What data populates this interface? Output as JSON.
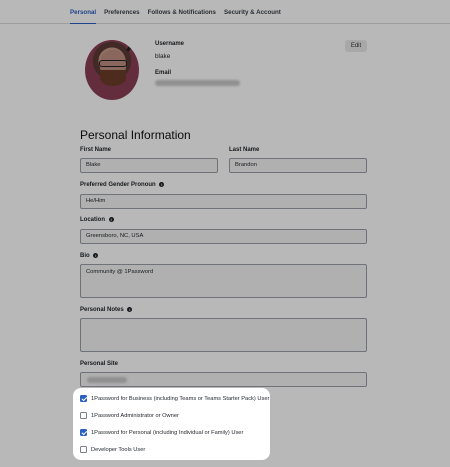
{
  "tabs": [
    "Personal",
    "Preferences",
    "Follows & Notifications",
    "Security & Account"
  ],
  "profile": {
    "username_label": "Username",
    "username": "blake",
    "email_label": "Email",
    "edit_label": "Edit"
  },
  "section_title": "Personal Information",
  "fields": {
    "first_name_label": "First Name",
    "first_name": "Blake",
    "last_name_label": "Last Name",
    "last_name": "Brandon",
    "pronoun_label": "Preferred Gender Pronoun",
    "pronoun": "He/Him",
    "location_label": "Location",
    "location": "Greensboro, NC, USA",
    "bio_label": "Bio",
    "bio": "Community @ 1Password",
    "notes_label": "Personal Notes",
    "notes": "",
    "site_label": "Personal Site"
  },
  "checkboxes": [
    {
      "label": "1Password for Business (including Teams or Teams Starter Pack) User",
      "checked": true
    },
    {
      "label": "1Password Administrator or Owner",
      "checked": false
    },
    {
      "label": "1Password for Personal (including Individual or Family) User",
      "checked": true
    },
    {
      "label": "Developer Tools User",
      "checked": false
    }
  ],
  "info_icon": "i",
  "colors": {
    "accent": "#2c5ebf"
  }
}
